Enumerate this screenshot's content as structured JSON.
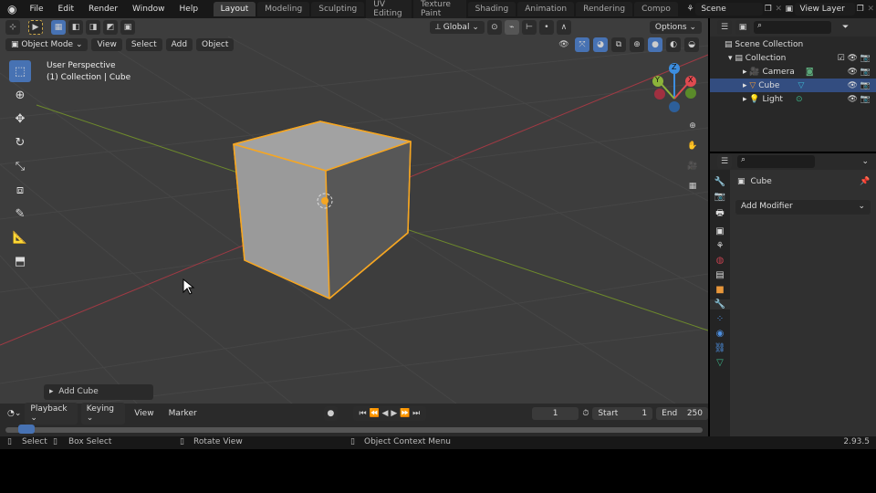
{
  "topbar": {
    "menus": [
      "File",
      "Edit",
      "Render",
      "Window",
      "Help"
    ],
    "tabs": [
      "Layout",
      "Modeling",
      "Sculpting",
      "UV Editing",
      "Texture Paint",
      "Shading",
      "Animation",
      "Rendering",
      "Compo"
    ],
    "scene": "Scene",
    "view_layer": "View Layer"
  },
  "viewport": {
    "transform": "Global",
    "options": "Options",
    "mode": "Object Mode",
    "menus": [
      "View",
      "Select",
      "Add",
      "Object"
    ],
    "perspective": "User Perspective",
    "collection_info": "(1) Collection | Cube",
    "last_op": "Add Cube",
    "gizmo": {
      "z": "Z",
      "y": "Y",
      "x": "X"
    }
  },
  "outliner": {
    "scene_collection": "Scene Collection",
    "collection": "Collection",
    "items": [
      "Camera",
      "Cube",
      "Light"
    ],
    "selected": "Cube"
  },
  "properties": {
    "object": "Cube",
    "add_modifier": "Add Modifier"
  },
  "timeline": {
    "menus": [
      "Playback",
      "Keying",
      "View",
      "Marker"
    ],
    "current_frame": "1",
    "start_label": "Start",
    "start": "1",
    "end_label": "End",
    "end": "250"
  },
  "status": {
    "select": "Select",
    "box_select": "Box Select",
    "rotate": "Rotate View",
    "context": "Object Context Menu",
    "version": "2.93.5"
  },
  "colors": {
    "accent": "#4772b3",
    "selection": "#f5a623",
    "x_axis": "#e04a50",
    "y_axis": "#8cb33a",
    "z_axis": "#3c8ee0"
  }
}
